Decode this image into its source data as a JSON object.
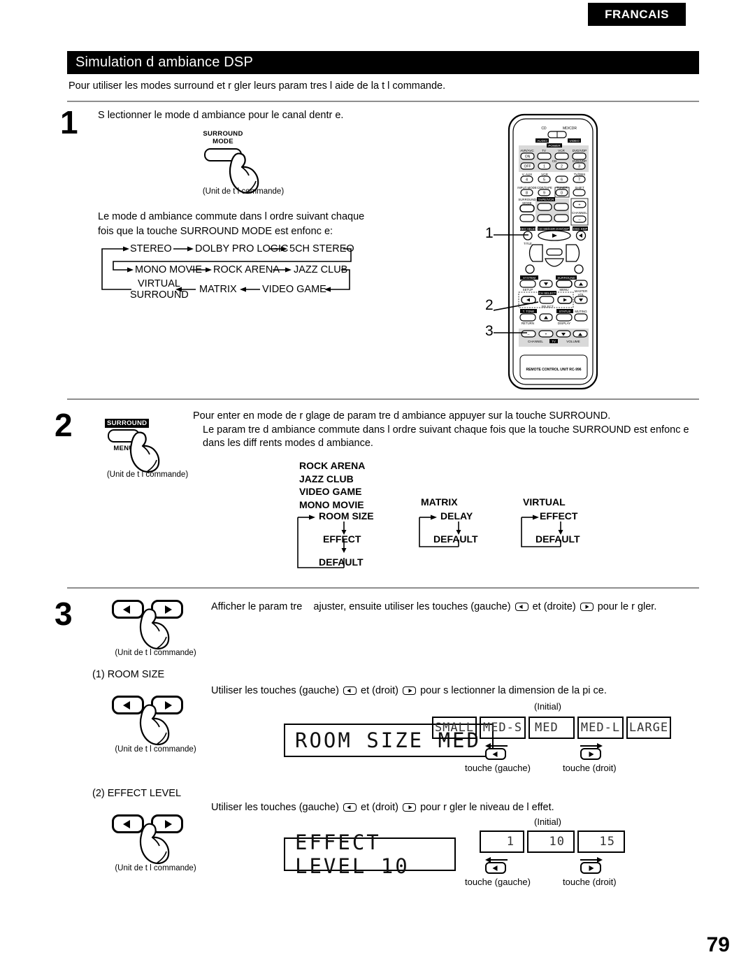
{
  "language_tab": "FRANCAIS",
  "page_number": "79",
  "section": {
    "title": "Simulation d  ambiance DSP",
    "intro": "Pour utiliser les modes surround et r  gler leurs param  tres    l aide de la t l  commande."
  },
  "remote_caption": "(Unit   de t l  commande)",
  "steps": {
    "one": {
      "number": "1",
      "instruction": "S lectionner le mode d ambiance pour le canal dentr  e.",
      "button_label_line1": "SURROUND",
      "button_label_line2": "MODE",
      "note": "Le mode d ambiance commute dans l ordre suivant chaque fois que la touche SURROUND MODE est enfonc  e:",
      "mode_flow": {
        "row1": [
          "STEREO",
          "DOLBY PRO LOGIC",
          "5CH STEREO"
        ],
        "row2": [
          "MONO MOVIE",
          "ROCK ARENA",
          "JAZZ CLUB"
        ],
        "row3": [
          "VIRTUAL SURROUND",
          "MATRIX",
          "VIDEO GAME"
        ],
        "row3_line1": "VIRTUAL",
        "row3_line2": "SURROUND"
      }
    },
    "two": {
      "number": "2",
      "button_label_top": "SURROUND",
      "button_label_bottom": "MENU",
      "line1": "Pour enter en mode de r  glage de param tre d ambiance appuyer sur la touche SURROUND.",
      "line2": "Le param  tre d ambiance commute dans l ordre suivant chaque fois que la touche SURROUND est enfonc  e",
      "line3": "dans les diff  rents modes d ambiance.",
      "groups": [
        {
          "modes": [
            "ROCK ARENA",
            "JAZZ CLUB",
            "VIDEO GAME",
            "MONO MOVIE"
          ],
          "params": [
            "ROOM SIZE",
            "EFFECT",
            "DEFAULT"
          ]
        },
        {
          "modes": [
            "MATRIX"
          ],
          "params": [
            "DELAY",
            "DEFAULT"
          ]
        },
        {
          "modes": [
            "VIRTUAL"
          ],
          "params": [
            "EFFECT",
            "DEFAULT"
          ]
        }
      ]
    },
    "three": {
      "number": "3",
      "instruction_a": "Afficher le param  tre",
      "instruction_b": "ajuster, ensuite utiliser les touches (gauche)",
      "instruction_c": "et (droite)",
      "instruction_d": "pour le r  gler.",
      "sub1": {
        "label": "(1) ROOM SIZE",
        "instruction_a": "Utiliser les touches (gauche)",
        "instruction_b": "et (droit)",
        "instruction_c": "pour s  lectionner la dimension de la pi  ce.",
        "display": "ROOM SIZE MED",
        "initial_label": "(Initial)",
        "options": [
          "SMALL",
          "MED-S",
          "MED",
          "MED-L",
          "LARGE"
        ],
        "key_left_label": "touche (gauche)",
        "key_right_label": "touche (droit)"
      },
      "sub2": {
        "label": "(2) EFFECT LEVEL",
        "instruction_a": "Utiliser les touches (gauche)",
        "instruction_b": "et (droit)",
        "instruction_c": "pour r  gler le niveau de l effet.",
        "display": "EFFECT LEVEL 10",
        "initial_label": "(Initial)",
        "options": [
          "1",
          "10",
          "15"
        ],
        "key_left_label": "touche (gauche)",
        "key_right_label": "touche (droit)"
      }
    }
  },
  "remote": {
    "model_label": "REMOTE CONTROL UNIT RC-996",
    "callouts": [
      "1",
      "2",
      "3"
    ],
    "source_selector": {
      "left": "CD",
      "right": "MD/CDR",
      "bottom_left": "AUDIO",
      "bottom_right": "VIDEO"
    },
    "power_label": "POWER",
    "power_rows": [
      {
        "name": "AVR/AVC",
        "key": "ON"
      },
      {
        "name": "",
        "key": "OFF"
      }
    ],
    "top_keys": [
      "TV",
      "VCR",
      "DVD/VDP"
    ],
    "numeric_rows": [
      [
        {
          "label": "CD",
          "num": "1"
        },
        {
          "label": "",
          "num": "2"
        },
        {
          "label": "DVD/VDP",
          "num": "3"
        }
      ],
      [
        {
          "label": "V. AUX",
          "num": "4"
        },
        {
          "label": "VCR",
          "num": "5"
        },
        {
          "label": "",
          "num": "6"
        },
        {
          "label": "TV/DBS",
          "num": "7"
        }
      ],
      [
        {
          "label": "INPUT MODE",
          "num": "8"
        },
        {
          "label": "CDR/TAPE",
          "num": "9"
        },
        {
          "label": "TUNER",
          "num": "0"
        },
        {
          "label": "SHIFT",
          "num": ""
        }
      ]
    ],
    "surround_mode_label": "SURROUND MODE",
    "tape_vcr_label": "TAPE/VCR",
    "channel_label": "CHANNEL",
    "title_label": "TITLE",
    "disc_skip_label": "DISC SKIP",
    "system_setup_label": "SYSTEM SETUP",
    "surround_menu_label": "SURROUND MENU",
    "master_vol_label": "MASTER VOL",
    "ch_select_label": "CH SELECT",
    "select_label": "SELECT",
    "tone_return_label": "T. TONE RETURN",
    "status_display_label": "STATUS DISPLAY",
    "muting_label": "MUTING",
    "bottom_row_label": "CHANNEL   TV   VOLUME"
  }
}
